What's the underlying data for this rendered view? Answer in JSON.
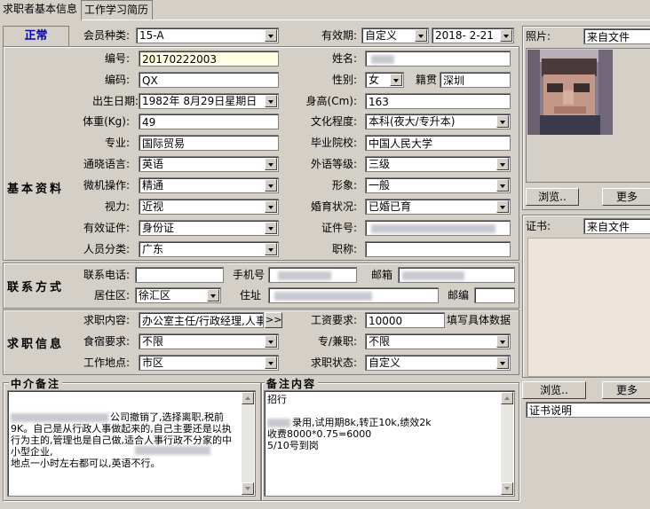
{
  "tabs": [
    "求职者基本信息",
    "工作学习简历"
  ],
  "status_label": "正常",
  "sections": {
    "basic": "基本资料",
    "contact": "联系方式",
    "jobinfo": "求职信息"
  },
  "fields": {
    "member_type": {
      "label": "会员种类:",
      "value": "15-A"
    },
    "validity": {
      "label": "有效期:",
      "value": "自定义",
      "date": "2018- 2-21"
    },
    "number": {
      "label": "编号:",
      "value": "20170222003"
    },
    "name": {
      "label": "姓名:",
      "value": ""
    },
    "code": {
      "label": "编码:",
      "value": "QX"
    },
    "gender": {
      "label": "性别:",
      "value": "女"
    },
    "native": {
      "label": "籍贯",
      "value": "深圳"
    },
    "birth": {
      "label": "出生日期:",
      "value": "1982年 8月29日星期日"
    },
    "height": {
      "label": "身高(Cm):",
      "value": "163"
    },
    "weight": {
      "label": "体重(Kg):",
      "value": "49"
    },
    "education": {
      "label": "文化程度:",
      "value": "本科(夜大/专升本)"
    },
    "major": {
      "label": "专业:",
      "value": "国际贸易"
    },
    "school": {
      "label": "毕业院校:",
      "value": "中国人民大学"
    },
    "language": {
      "label": "通晓语言:",
      "value": "英语"
    },
    "lang_level": {
      "label": "外语等级:",
      "value": "三级"
    },
    "computer": {
      "label": "微机操作:",
      "value": "精通"
    },
    "appearance": {
      "label": "形象:",
      "value": "一般"
    },
    "vision": {
      "label": "视力:",
      "value": "近视"
    },
    "marital": {
      "label": "婚育状况:",
      "value": "已婚已育"
    },
    "id_type": {
      "label": "有效证件:",
      "value": "身份证"
    },
    "id_number": {
      "label": "证件号:",
      "value": ""
    },
    "category": {
      "label": "人员分类:",
      "value": "广东"
    },
    "title": {
      "label": "职称:",
      "value": ""
    },
    "phone": {
      "label": "联系电话:",
      "value": ""
    },
    "mobile": {
      "label": "手机号",
      "value": ""
    },
    "email": {
      "label": "邮箱",
      "value": ""
    },
    "district": {
      "label": "居住区:",
      "value": "徐汇区"
    },
    "address": {
      "label": "住址",
      "value": ""
    },
    "postcode": {
      "label": "邮编",
      "value": ""
    },
    "job_content": {
      "label": "求职内容:",
      "value": "办公室主任/行政经理,人事"
    },
    "salary": {
      "label": "工资要求:",
      "value": "10000",
      "hint": "填写具体数据"
    },
    "board": {
      "label": "食宿要求:",
      "value": "不限"
    },
    "fulltime": {
      "label": "专/兼职:",
      "value": "不限"
    },
    "location": {
      "label": "工作地点:",
      "value": "市区"
    },
    "job_status": {
      "label": "求职状态:",
      "value": "自定义"
    }
  },
  "more_button": ">>",
  "photo": {
    "label": "照片:",
    "source": "来自文件",
    "browse": "浏览..",
    "more": "更多"
  },
  "certificate": {
    "label": "证书:",
    "source": "来自文件",
    "browse": "浏览..",
    "more": "更多",
    "note": "证书说明"
  },
  "agency_notes": {
    "title": "中介备注",
    "line1": "公司撤销了,选择离职,税前9K。自己是从行政人事做起来的,自己主要还是以执行为主的,管理也是自己做,适合人事行政不分家的中小型企业,",
    "line2": "地点一小时左右都可以,英语不行。"
  },
  "remarks": {
    "title": "备注内容",
    "lines": [
      "招行",
      "",
      "录用,试用期8k,转正10k,绩效2k",
      "收费8000*0.75=6000",
      "5/10号到岗"
    ]
  },
  "colors": {
    "status_blue": "#0000c0",
    "window_bg": "#d4d0c8",
    "field_yellow": "#ffffe1"
  }
}
